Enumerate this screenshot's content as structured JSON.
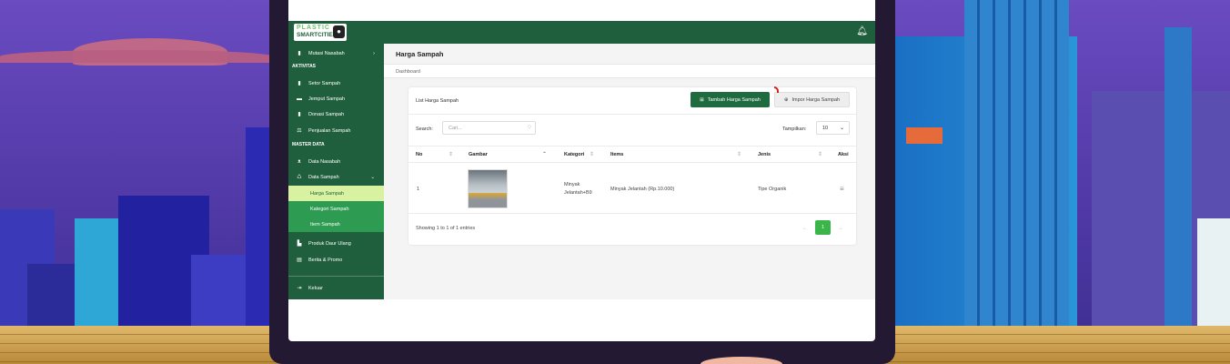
{
  "app": {
    "logo_top": "PLASTIC",
    "logo_bottom": "SMARTCITIES",
    "logo_badge": "WWF",
    "bell_icon": "bell-icon"
  },
  "sidebar": {
    "mutasi": "Mutasi Nasabah",
    "section_aktivitas": "AKTIVITAS",
    "items": [
      "Setor Sampah",
      "Jemput Sampah",
      "Donasi Sampah",
      "Penjualan Sampah"
    ],
    "section_master": "MASTER DATA",
    "data_nasabah": "Data Nasabah",
    "data_sampah": "Data Sampah",
    "sub_items": [
      "Harga Sampah",
      "Kategori Sampah",
      "Item Sampah"
    ],
    "produk": "Produk Daur Ulang",
    "berita": "Berita & Promo",
    "keluar": "Keluar"
  },
  "main": {
    "title": "Harga Sampah",
    "breadcrumb": "Dashboard",
    "card_title": "List Harga Sampah",
    "btn_add": "Tambah Harga Sampah",
    "btn_import": "Impor Harga Sampah",
    "search_label": "Search:",
    "search_placeholder": "Cari...",
    "show_label": "Tampilkan:",
    "show_value": "10",
    "columns": [
      "No",
      "Gambar",
      "Kategori",
      "Items",
      "Jenis",
      "Aksi"
    ],
    "rows": [
      {
        "no": "1",
        "kategori_1": "Minyak",
        "kategori_2": "Jelantah+B9",
        "item": "Minyak Jelantah (Rp.10.000)",
        "jenis": "Tipe Organik"
      }
    ],
    "footer": "Showing 1 to 1 of 1 entries",
    "page_prev": "←",
    "page_current": "1",
    "page_next": "→"
  },
  "colors": {
    "brand_green": "#1f5f3d",
    "active_sub": "#d9f2a2",
    "accent_green": "#3bb54a"
  }
}
